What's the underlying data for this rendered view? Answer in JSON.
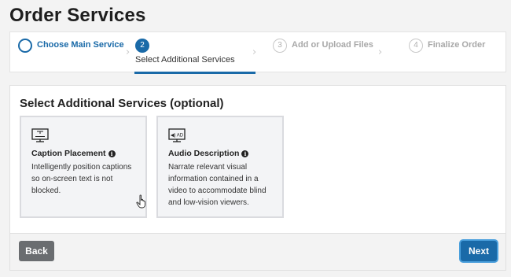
{
  "page": {
    "title": "Order Services"
  },
  "stepper": {
    "steps": [
      {
        "number": "",
        "label": "Choose Main Service",
        "state": "done"
      },
      {
        "number": "2",
        "label": "Select Additional Services",
        "state": "active"
      },
      {
        "number": "3",
        "label": "Add or Upload Files",
        "state": "pending"
      },
      {
        "number": "4",
        "label": "Finalize Order",
        "state": "pending"
      }
    ]
  },
  "panel": {
    "heading": "Select Additional Services (optional)",
    "cards": [
      {
        "icon": "caption-monitor-icon",
        "title": "Caption Placement",
        "description": "Intelligently position captions so on-screen text is not blocked."
      },
      {
        "icon": "audio-description-monitor-icon",
        "icon_text": "◀) AD",
        "title": "Audio Description",
        "description": "Narrate relevant visual information contained in a video to accommodate blind and low-vision viewers."
      }
    ]
  },
  "footer": {
    "back_label": "Back",
    "next_label": "Next"
  },
  "colors": {
    "accent": "#1a6aa8",
    "back_button": "#6a6d70",
    "card_bg": "#f3f4f6"
  }
}
